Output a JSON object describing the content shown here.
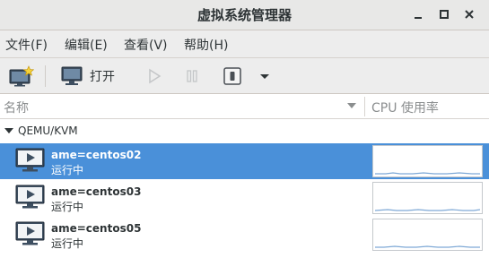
{
  "window": {
    "title": "虚拟系统管理器",
    "controls": [
      "minimize-icon",
      "maximize-icon",
      "close-icon"
    ]
  },
  "menubar": {
    "items": [
      {
        "label": "文件(F)"
      },
      {
        "label": "编辑(E)"
      },
      {
        "label": "查看(V)"
      },
      {
        "label": "帮助(H)"
      }
    ]
  },
  "toolbar": {
    "new_vm_icon": "new-vm-icon",
    "open_icon": "monitor-icon",
    "open_label": "打开",
    "run_icon": "play-icon",
    "pause_icon": "pause-icon",
    "shutdown_icon": "power-icon",
    "menu_icon": "dropdown-arrow-icon"
  },
  "columns": {
    "name": "名称",
    "cpu": "CPU 使用率"
  },
  "group": {
    "label": "QEMU/KVM",
    "expanded": true
  },
  "vms": [
    {
      "name": "ame=centos02",
      "status": "运行中",
      "selected": true
    },
    {
      "name": "ame=centos03",
      "status": "运行中",
      "selected": false
    },
    {
      "name": "ame=centos05",
      "status": "运行中",
      "selected": false
    }
  ],
  "colors": {
    "selection": "#4a90d9",
    "graph_line": "#7fa9d6"
  }
}
